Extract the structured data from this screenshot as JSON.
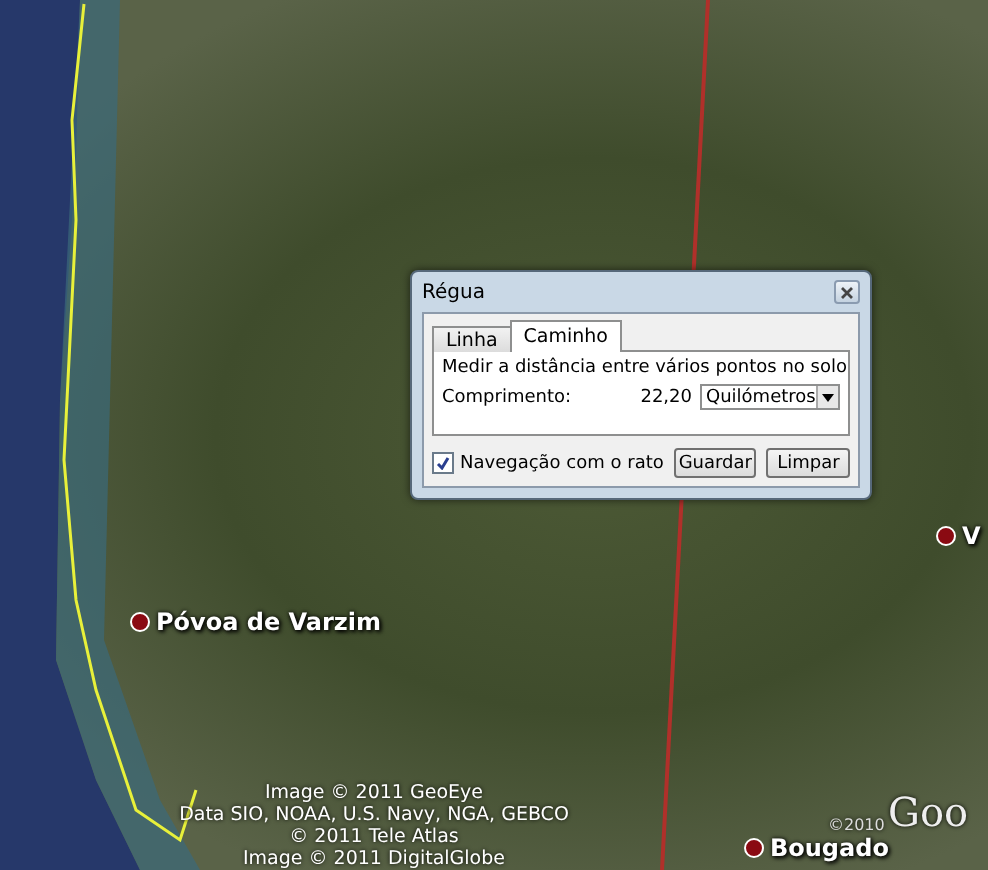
{
  "map": {
    "places": [
      {
        "name": "Póvoa de Varzim"
      },
      {
        "name": "V"
      },
      {
        "name": "Bougado"
      }
    ],
    "attribution": [
      "Image © 2011 GeoEye",
      "Data SIO, NOAA, U.S. Navy, NGA, GEBCO",
      "© 2011 Tele Atlas",
      "Image © 2011 DigitalGlobe"
    ],
    "copyright": "©2010",
    "logo": "Goo"
  },
  "dialog": {
    "title": "Régua",
    "tabs": [
      {
        "label": "Linha",
        "selected": false
      },
      {
        "label": "Caminho",
        "selected": true
      }
    ],
    "description": "Medir a distância entre vários pontos no solo",
    "length_label": "Comprimento:",
    "length_value": "22,20",
    "unit": "Quilómetros",
    "mouse_navigation": {
      "label": "Navegação com o rato",
      "checked": true
    },
    "buttons": [
      "Guardar",
      "Limpar"
    ]
  }
}
